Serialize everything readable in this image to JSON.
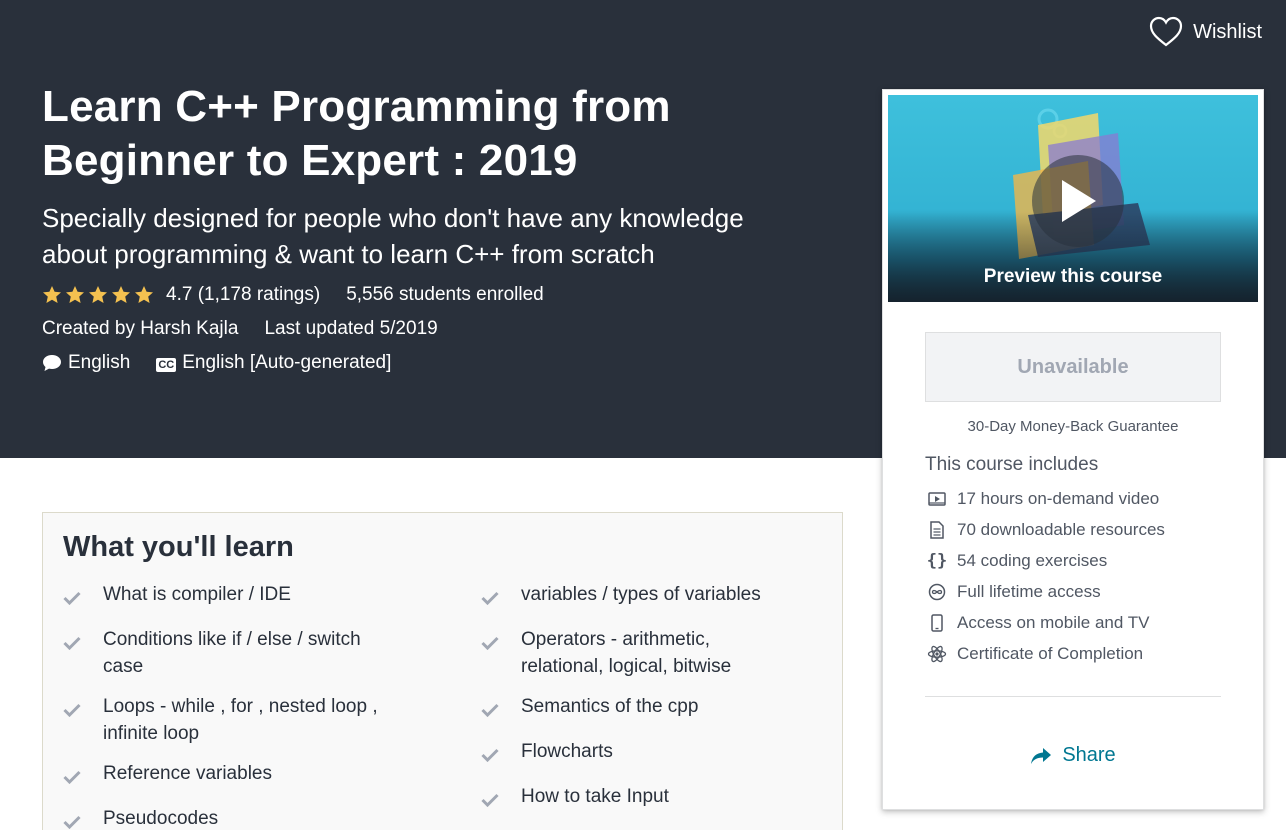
{
  "header": {
    "wishlist_label": "Wishlist"
  },
  "course": {
    "title_line1": "Learn C++ Programming from",
    "title_line2": "Beginner to Expert : 2019",
    "subtitle_line1": "Specially designed for people who don't have any knowledge",
    "subtitle_line2": "about programming & want to learn C++ from scratch",
    "rating": "4.7 (1,178 ratings)",
    "stars": 5,
    "enrolled": "5,556 students enrolled",
    "created_by": "Created by Harsh Kajla",
    "last_updated": "Last updated 5/2019",
    "language": "English",
    "captions_icon": "CC",
    "captions": "English [Auto-generated]"
  },
  "sidebar": {
    "preview_label": "Preview this course",
    "button_label": "Unavailable",
    "guarantee": "30-Day Money-Back Guarantee",
    "includes_title": "This course includes",
    "includes": [
      {
        "icon": "video-icon",
        "text": "17 hours on-demand video"
      },
      {
        "icon": "file-icon",
        "text": "70 downloadable resources"
      },
      {
        "icon": "code-icon",
        "text": "54 coding exercises"
      },
      {
        "icon": "infinity-icon",
        "text": "Full lifetime access"
      },
      {
        "icon": "mobile-icon",
        "text": "Access on mobile and TV"
      },
      {
        "icon": "certificate-icon",
        "text": "Certificate of Completion"
      }
    ],
    "share_label": "Share"
  },
  "learn": {
    "title": "What you'll learn",
    "left": [
      {
        "line1": "What is compiler / IDE"
      },
      {
        "line1": "Conditions like if / else / switch",
        "line2": "case"
      },
      {
        "line1": "Loops - while , for , nested loop ,",
        "line2": "infinite loop"
      },
      {
        "line1": "Reference variables"
      },
      {
        "line1": "Pseudocodes"
      }
    ],
    "right": [
      {
        "line1": "variables / types of variables"
      },
      {
        "line1": "Operators - arithmetic,",
        "line2": "relational, logical, bitwise"
      },
      {
        "line1": "Semantics of the cpp"
      },
      {
        "line1": "Flowcharts"
      },
      {
        "line1": "How to take Input"
      }
    ]
  },
  "colors": {
    "hero_bg": "#29303b",
    "star": "#f4c150",
    "link": "#007791"
  }
}
